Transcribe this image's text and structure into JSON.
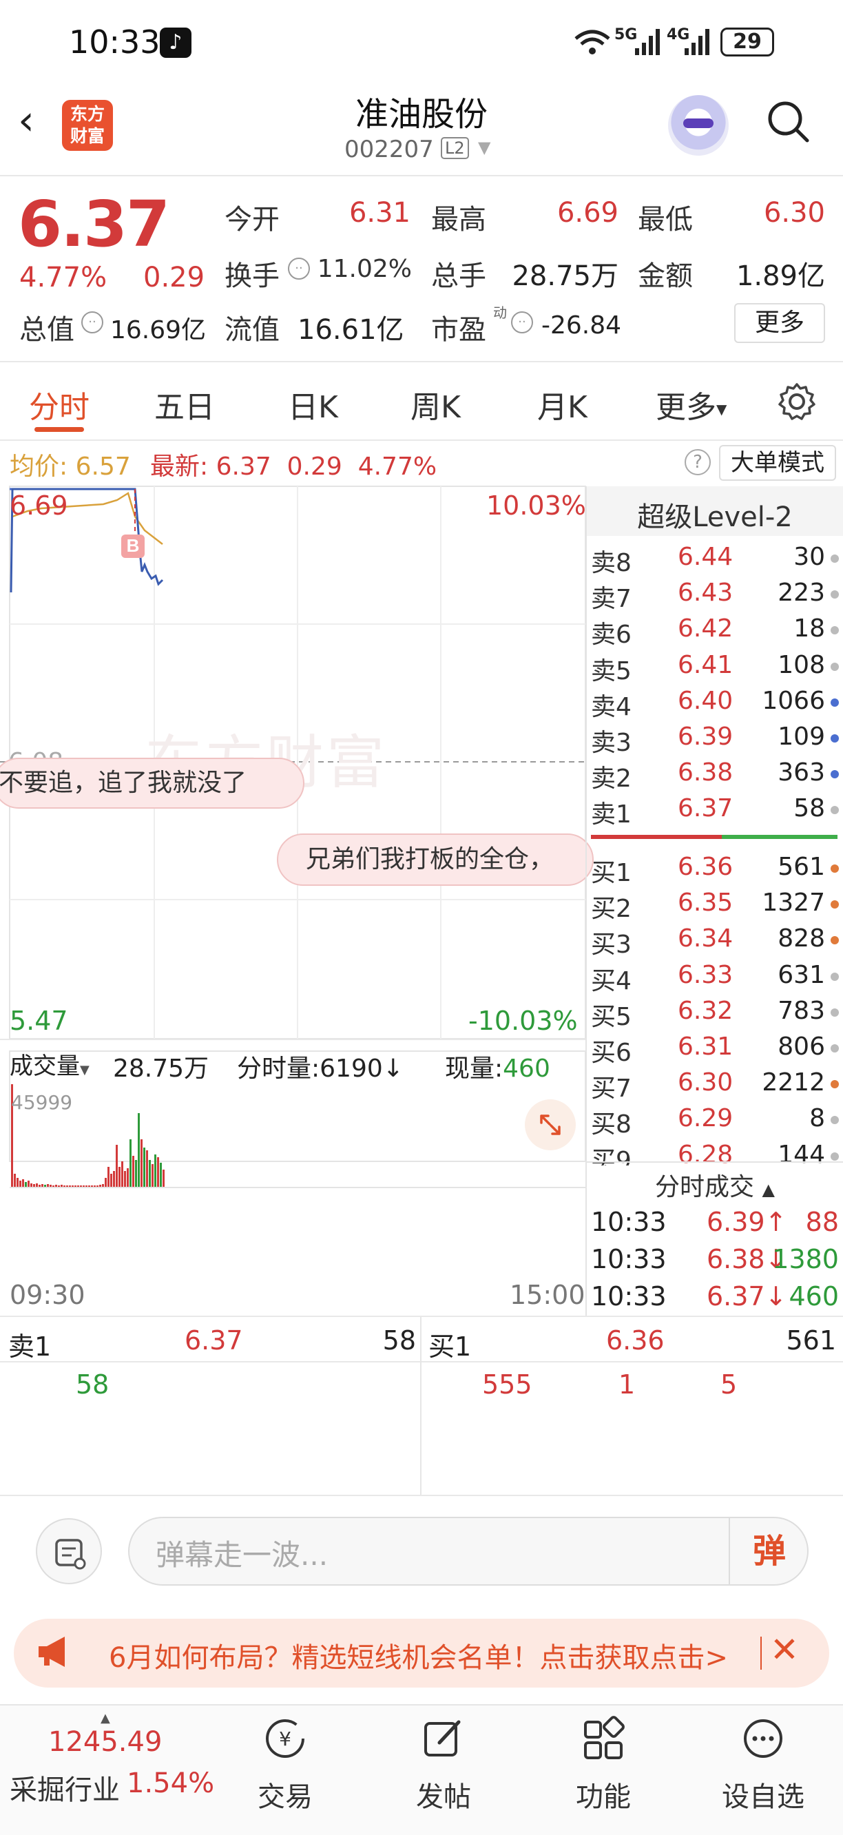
{
  "status_bar": {
    "time": "10:33",
    "signal_5g": "5G",
    "signal_4g": "4G",
    "battery": "29"
  },
  "header": {
    "stock_name": "准油股份",
    "stock_code": "002207",
    "level_badge": "L2",
    "logo_line1": "东方",
    "logo_line2": "财富"
  },
  "quote": {
    "price": "6.37",
    "change_pct": "4.77%",
    "change": "0.29",
    "open_label": "今开",
    "open": "6.31",
    "high_label": "最高",
    "high": "6.69",
    "low_label": "最低",
    "low": "6.30",
    "turnover_label": "换手",
    "turnover": "11.02%",
    "volume_label": "总手",
    "volume": "28.75万",
    "amount_label": "金额",
    "amount": "1.89亿",
    "mktcap_label": "总值",
    "mktcap": "16.69亿",
    "float_label": "流值",
    "float_cap": "16.61亿",
    "pe_label": "市盈",
    "pe_sup": "动",
    "pe": "-26.84",
    "more_button": "更多"
  },
  "tabs": [
    "分时",
    "五日",
    "日K",
    "周K",
    "月K",
    "更多"
  ],
  "info_line": {
    "avg_label": "均价:",
    "avg": "6.57",
    "latest_label": "最新:",
    "latest": "6.37",
    "latest_change": "0.29",
    "latest_pct": "4.77%",
    "mode_button": "大单模式"
  },
  "chart": {
    "top_left": "6.69",
    "top_right": "10.03%",
    "bottom_left": "5.47",
    "bottom_right": "-10.03%",
    "mid_left": "6.08",
    "watermark": "东方财富",
    "marker": "B",
    "vol_selector": "成交量",
    "vol_total": "28.75万",
    "tick_vol_label": "分时量:",
    "tick_vol": "6190",
    "cur_vol_label": "现量:",
    "cur_vol": "460",
    "vol_max": "45999",
    "time_start": "09:30",
    "time_end": "15:00"
  },
  "danmu": {
    "msg1": "不要追，追了我就没了",
    "msg2": "兄弟们我打板的全仓，"
  },
  "order_book": {
    "title": "超级Level-2",
    "asks": [
      {
        "label": "卖8",
        "price": "6.44",
        "vol": "30",
        "dot": "#bbbbbb"
      },
      {
        "label": "卖7",
        "price": "6.43",
        "vol": "223",
        "dot": "#bbbbbb"
      },
      {
        "label": "卖6",
        "price": "6.42",
        "vol": "18",
        "dot": "#bbbbbb"
      },
      {
        "label": "卖5",
        "price": "6.41",
        "vol": "108",
        "dot": "#bbbbbb"
      },
      {
        "label": "卖4",
        "price": "6.40",
        "vol": "1066",
        "dot": "#4a6ed0"
      },
      {
        "label": "卖3",
        "price": "6.39",
        "vol": "109",
        "dot": "#4a6ed0"
      },
      {
        "label": "卖2",
        "price": "6.38",
        "vol": "363",
        "dot": "#4a6ed0"
      },
      {
        "label": "卖1",
        "price": "6.37",
        "vol": "58",
        "dot": "#bbbbbb"
      }
    ],
    "bids": [
      {
        "label": "买1",
        "price": "6.36",
        "vol": "561",
        "dot": "#e07a3a"
      },
      {
        "label": "买2",
        "price": "6.35",
        "vol": "1327",
        "dot": "#e07a3a"
      },
      {
        "label": "买3",
        "price": "6.34",
        "vol": "828",
        "dot": "#e07a3a"
      },
      {
        "label": "买4",
        "price": "6.33",
        "vol": "631",
        "dot": "#bbbbbb"
      },
      {
        "label": "买5",
        "price": "6.32",
        "vol": "783",
        "dot": "#bbbbbb"
      },
      {
        "label": "买6",
        "price": "6.31",
        "vol": "806",
        "dot": "#bbbbbb"
      },
      {
        "label": "买7",
        "price": "6.30",
        "vol": "2212",
        "dot": "#e07a3a"
      },
      {
        "label": "买8",
        "price": "6.29",
        "vol": "8",
        "dot": "#bbbbbb"
      },
      {
        "label": "买9",
        "price": "6.28",
        "vol": "144",
        "dot": "#bbbbbb"
      }
    ],
    "ticks_title": "分时成交",
    "ticks": [
      {
        "time": "10:33",
        "price": "6.39↑",
        "vol": "88",
        "pcolor": "#d23a3a",
        "vcolor": "#d23a3a"
      },
      {
        "time": "10:33",
        "price": "6.38↓",
        "vol": "1380",
        "pcolor": "#d23a3a",
        "vcolor": "#2e9a3a"
      },
      {
        "time": "10:33",
        "price": "6.37↓",
        "vol": "460",
        "pcolor": "#d23a3a",
        "vcolor": "#2e9a3a"
      }
    ]
  },
  "queue": {
    "sell_label": "卖1",
    "sell_price": "6.37",
    "sell_vol": "58",
    "buy_label": "买1",
    "buy_price": "6.36",
    "buy_vol": "561",
    "sell_orders": [
      "58"
    ],
    "buy_orders": [
      "555",
      "1",
      "5"
    ]
  },
  "danmu_input": {
    "placeholder": "弹幕走一波...",
    "send": "弹"
  },
  "banner": {
    "text": "6月如何布局？精选短线机会名单！点击获取点击>"
  },
  "bottom_nav": {
    "index_value": "1245.49",
    "index_name": "采掘行业",
    "index_pct": "1.54%",
    "items": [
      "交易",
      "发帖",
      "功能",
      "设自选"
    ]
  },
  "colors": {
    "up": "#d23a3a",
    "down": "#2e9a3a",
    "avg": "#d9a13b",
    "accent": "#e0502a"
  }
}
